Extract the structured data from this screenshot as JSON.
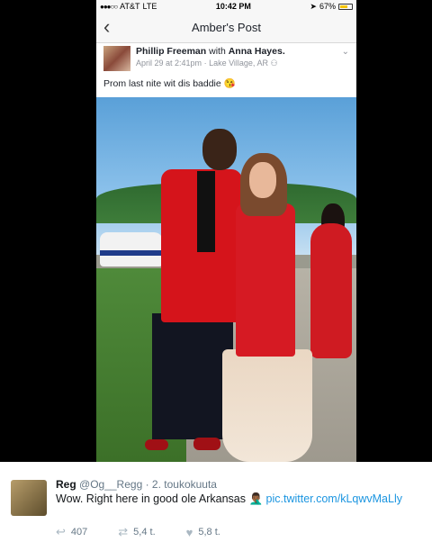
{
  "statusbar": {
    "carrier": "AT&T",
    "network": "LTE",
    "time": "10:42 PM",
    "battery": "67%",
    "battery_level": 0.67
  },
  "navbar": {
    "title": "Amber's Post"
  },
  "post": {
    "author": "Phillip Freeman",
    "with_text": "with",
    "tagged": "Anna Hayes.",
    "date": "April 29 at 2:41pm",
    "location": "Lake Village, AR",
    "text": "Prom last nite wit dis baddie",
    "emoji": "😘"
  },
  "tweet": {
    "name": "Reg",
    "handle": "@Og__Regg",
    "date": "· 2. toukokuuta",
    "text": "Wow. Right here in good ole Arkansas 🤦🏾‍♂️",
    "link": "pic.twitter.com/kLqwvMaLly",
    "replies": "407",
    "retweets": "5,4 t.",
    "likes": "5,8 t."
  },
  "icons": {
    "back": "chevron-left-icon",
    "reply": "reply-icon",
    "retweet": "retweet-icon",
    "like": "heart-icon"
  },
  "colors": {
    "link": "#1b95e0",
    "battery": "#f5c400"
  }
}
